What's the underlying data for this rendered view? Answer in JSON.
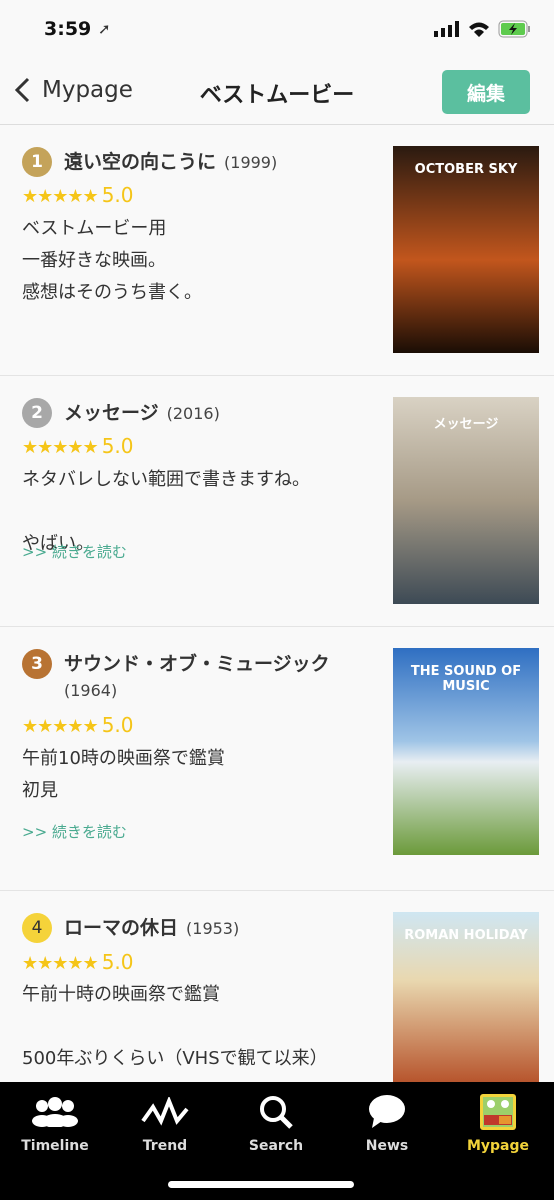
{
  "status": {
    "time": "3:59"
  },
  "nav": {
    "back_label": "Mypage",
    "title": "ベストムービー",
    "edit_label": "編集"
  },
  "movies": [
    {
      "rank": "1",
      "title": "遠い空の向こうに",
      "year": "(1999)",
      "rating": "5.0",
      "body": "ベストムービー用\n一番好きな映画。\n感想はそのうち書く。",
      "more": "",
      "poster": "OCTOBER SKY",
      "badge_color": "#c4a35a"
    },
    {
      "rank": "2",
      "title": "メッセージ",
      "year": "(2016)",
      "rating": "5.0",
      "body": "ネタバレしない範囲で書きますね。\n\nやばい。",
      "more": ">> 続きを読む",
      "poster": "メッセージ",
      "badge_color": "#a8a8a8"
    },
    {
      "rank": "3",
      "title": "サウンド・オブ・ミュージック",
      "year": "(1964)",
      "rating": "5.0",
      "body": "午前10時の映画祭で鑑賞\n初見",
      "more": ">> 続きを読む",
      "poster": "THE SOUND OF MUSIC",
      "badge_color": "#b87333"
    },
    {
      "rank": "4",
      "title": "ローマの休日",
      "year": "(1953)",
      "rating": "5.0",
      "body": "午前十時の映画祭で鑑賞\n\n500年ぶりくらい（VHSで観て以来）",
      "more": "",
      "poster": "ROMAN HOLIDAY",
      "badge_color": "#f5d33a"
    }
  ],
  "stars": "★★★★★",
  "tabs": [
    {
      "label": "Timeline",
      "icon": "people-icon"
    },
    {
      "label": "Trend",
      "icon": "trend-icon"
    },
    {
      "label": "Search",
      "icon": "search-icon"
    },
    {
      "label": "News",
      "icon": "speech-bubble-icon"
    },
    {
      "label": "Mypage",
      "icon": "frog-avatar-icon",
      "active": true
    }
  ],
  "colors": {
    "accent": "#5bbf9f",
    "active_tab": "#f2d33a",
    "star": "#f5c518"
  }
}
